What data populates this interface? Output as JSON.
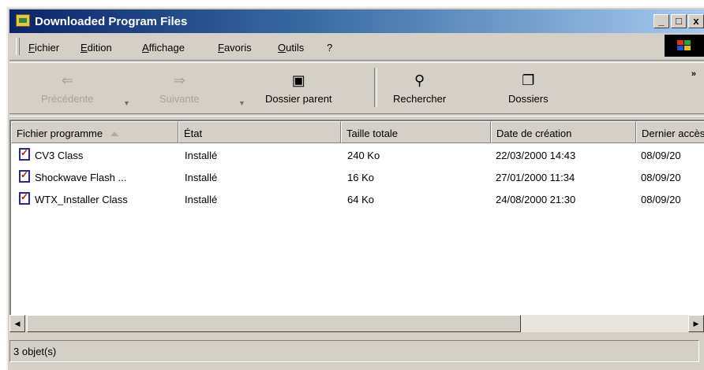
{
  "window": {
    "title": "Downloaded Program Files"
  },
  "title_buttons": {
    "minimize": "_",
    "maximize": "□",
    "close": "x"
  },
  "menu": [
    "Fichier",
    "Edition",
    "Affichage",
    "Favoris",
    "Outils",
    "?"
  ],
  "toolbar": {
    "back": {
      "label": "Précédente",
      "icon": "back-arrow-icon"
    },
    "forward": {
      "label": "Suivante",
      "icon": "forward-arrow-icon"
    },
    "up": {
      "label": "Dossier parent",
      "icon": "folder-up-icon"
    },
    "search": {
      "label": "Rechercher",
      "icon": "search-icon"
    },
    "folders": {
      "label": "Dossiers",
      "icon": "folders-icon"
    },
    "more": "»"
  },
  "columns": [
    "Fichier programme",
    "État",
    "Taille totale",
    "Date de création",
    "Dernier accès"
  ],
  "rows": [
    {
      "name": "CV3 Class",
      "status": "Installé",
      "size": "240 Ko",
      "created": "22/03/2000 14:43",
      "last": "08/09/20"
    },
    {
      "name": "Shockwave Flash ...",
      "status": "Installé",
      "size": "16 Ko",
      "created": "27/01/2000 11:34",
      "last": "08/09/20"
    },
    {
      "name": "WTX_Installer Class",
      "status": "Installé",
      "size": "64 Ko",
      "created": "24/08/2000 21:30",
      "last": "08/09/20"
    }
  ],
  "statusbar": {
    "text": "3 objet(s)"
  },
  "colors": {
    "title_start": "#0a246a",
    "title_end": "#a6caf0",
    "chrome": "#d4d0c8"
  }
}
